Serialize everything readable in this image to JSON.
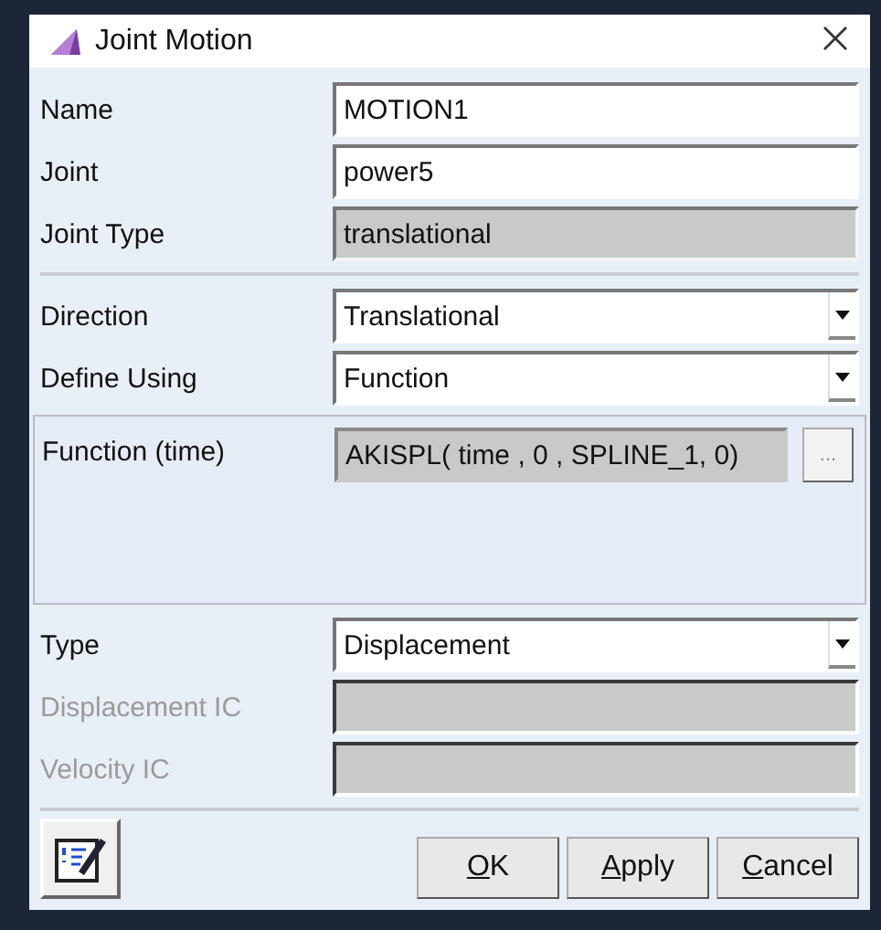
{
  "window": {
    "title": "Joint Motion"
  },
  "fields_top": [
    {
      "label": "Name",
      "value": "MOTION1",
      "kind": "text",
      "disabled": false,
      "readonly": false
    },
    {
      "label": "Joint",
      "value": "power5",
      "kind": "text",
      "disabled": false,
      "readonly": false
    },
    {
      "label": "Joint Type",
      "value": "translational",
      "kind": "text",
      "disabled": false,
      "readonly": true
    }
  ],
  "fields_mid": [
    {
      "label": "Direction",
      "value": "Translational",
      "kind": "dropdown",
      "disabled": false,
      "readonly": false
    },
    {
      "label": "Define Using",
      "value": "Function",
      "kind": "dropdown",
      "disabled": false,
      "readonly": false
    }
  ],
  "function": {
    "label": "Function (time)",
    "value": "AKISPL( time , 0 , SPLINE_1, 0)",
    "button": "..."
  },
  "fields_bottom": [
    {
      "label": "Type",
      "value": "Displacement",
      "kind": "dropdown",
      "disabled": false,
      "readonly": false
    },
    {
      "label": "Displacement IC",
      "kind": "text",
      "disabled": true,
      "readonly": false
    },
    {
      "label": "Velocity IC",
      "kind": "text",
      "disabled": true,
      "readonly": false
    }
  ],
  "buttons": [
    {
      "label": "OK",
      "underline_first": true
    },
    {
      "label": "Apply",
      "underline_first": true
    },
    {
      "label": "Cancel",
      "underline_first": true
    }
  ]
}
